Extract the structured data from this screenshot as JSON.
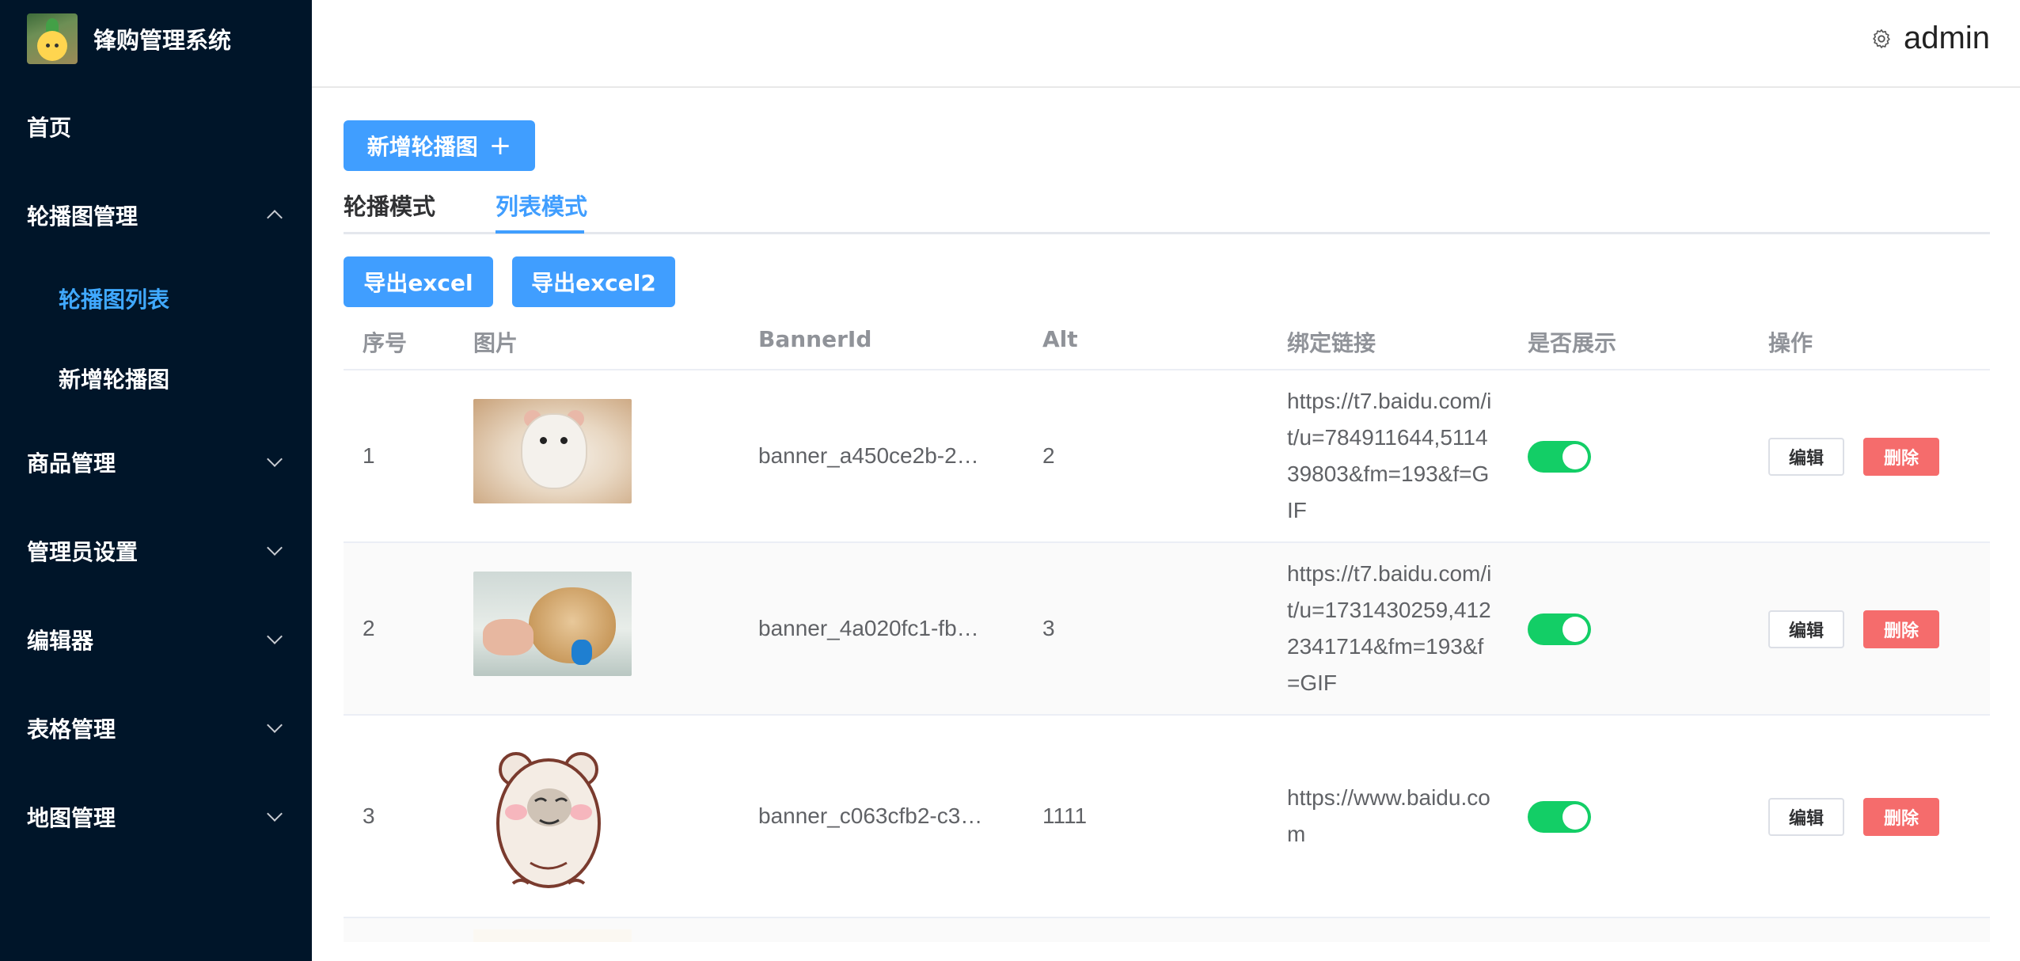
{
  "app": {
    "title": "锋购管理系统",
    "logo_icon": "pineapple-logo"
  },
  "sidebar": {
    "items": [
      {
        "label": "首页"
      },
      {
        "label": "轮播图管理",
        "expanded": true
      },
      {
        "label": "轮播图列表",
        "active": true
      },
      {
        "label": "新增轮播图"
      },
      {
        "label": "商品管理"
      },
      {
        "label": "管理员设置"
      },
      {
        "label": "编辑器"
      },
      {
        "label": "表格管理"
      },
      {
        "label": "地图管理"
      }
    ],
    "colors": {
      "background": "#001529",
      "active": "#40a9ff"
    }
  },
  "header": {
    "user_name": "admin",
    "settings_icon": "gear-icon"
  },
  "toolbar": {
    "add_banner_label": "新增轮播图",
    "add_icon": "plus-icon"
  },
  "tabs": [
    {
      "label": "轮播模式"
    },
    {
      "label": "列表模式",
      "active": true
    }
  ],
  "actions": {
    "export1_label": "导出excel",
    "export2_label": "导出excel2"
  },
  "table": {
    "columns": [
      "序号",
      "图片",
      "BannerId",
      "Alt",
      "绑定链接",
      "是否展示",
      "操作"
    ],
    "rows": [
      {
        "index": "1",
        "image": "hamster photo",
        "banner_id": "banner_a450ce2b-2…",
        "alt": "2",
        "link": "https://t7.baidu.com/it/u=784911644,511439803&fm=193&f=GIF",
        "show": true,
        "edit": "编辑",
        "delete": "删除"
      },
      {
        "index": "2",
        "image": "cat being brushed photo",
        "banner_id": "banner_4a020fc1-fb…",
        "alt": "3",
        "link": "https://t7.baidu.com/it/u=1731430259,4122341714&fm=193&f=GIF",
        "show": true,
        "edit": "编辑",
        "delete": "删除"
      },
      {
        "index": "3",
        "image": "cartoon bear meme",
        "banner_id": "banner_c063cfb2-c3…",
        "alt": "1111",
        "link": "https://www.baidu.com",
        "show": true,
        "edit": "编辑",
        "delete": "删除"
      }
    ]
  },
  "colors": {
    "primary": "#409eff",
    "danger": "#f56c6c",
    "switch_on": "#13ce66"
  }
}
